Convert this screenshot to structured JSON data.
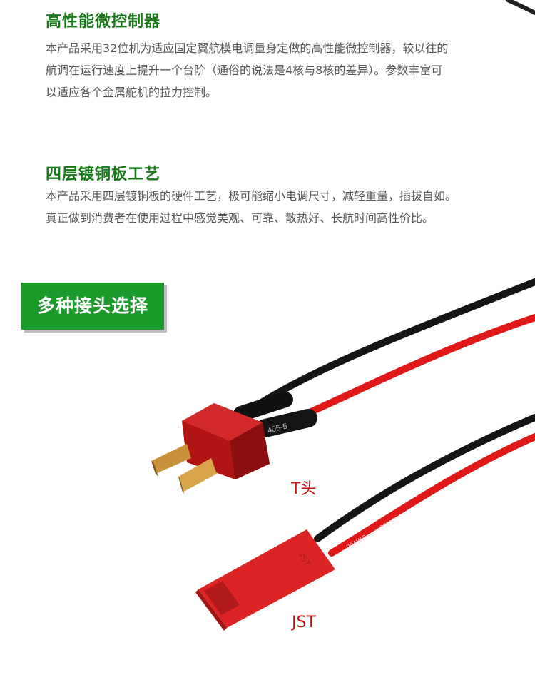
{
  "section1": {
    "title": "高性能微控制器",
    "lines": [
      "本产品采用32位机为适应固定翼航模电调量身定做的高性能微控制器，较以往的",
      "航调在运行速度上提升一个台阶（通俗的说法是4核与8核的差异）。参数丰富可",
      "以适应各个金属舵机的拉力控制。"
    ]
  },
  "section2": {
    "title": "四层镀铜板工艺",
    "lines": [
      "本产品采用四层镀铜板的硬件工艺，极可能缩小电调尺寸，减轻重量，插拔自如。",
      "真正做到消费者在使用过程中感觉美观、可靠、散热好、长航时间高性价比。"
    ]
  },
  "banner": {
    "title": "多种接头选择"
  },
  "connectors": [
    {
      "label": "T头"
    },
    {
      "label": "JST"
    }
  ],
  "colors": {
    "heading": "#1a7a1a",
    "banner": "#1a9a2a",
    "text": "#555555",
    "label": "#cc1111"
  }
}
